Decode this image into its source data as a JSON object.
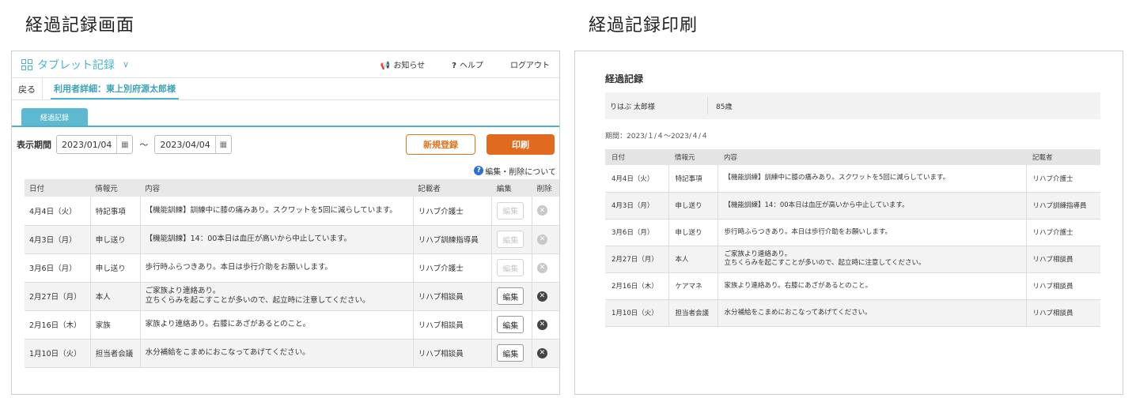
{
  "captions": {
    "left": "経過記録画面",
    "right": "経過記録印刷"
  },
  "app": {
    "brand": "タブレット記録",
    "top_links": [
      {
        "icon": "megaphone-icon",
        "glyph": "📢",
        "label": "お知らせ"
      },
      {
        "icon": "help-icon",
        "glyph": "?",
        "label": "ヘルプ"
      },
      {
        "icon": "",
        "glyph": "",
        "label": "ログアウト"
      }
    ],
    "back": "戻る",
    "user_crumb": "利用者詳細：東上別府源太郎様",
    "tab": "経過記録",
    "filter": {
      "label": "表示期間",
      "from": "2023/01/04",
      "to": "2023/04/04",
      "tilde": "〜",
      "new_button": "新規登録",
      "print_button": "印刷"
    },
    "note": "編集・削除について",
    "headers": [
      "日付",
      "情報元",
      "内容",
      "記載者",
      "編集",
      "削除"
    ],
    "edit_label": "編集",
    "rows": [
      {
        "date": "4月4日（火）",
        "source": "特記事項",
        "content": "【機能訓練】訓練中に膝の痛みあり。スクワットを5回に減らしています。",
        "author": "リハブ介護士",
        "editable": false
      },
      {
        "date": "4月3日（月）",
        "source": "申し送り",
        "content": "【機能訓練】14：00本日は血圧が高いから中止しています。",
        "author": "リハブ訓練指導員",
        "editable": false
      },
      {
        "date": "3月6日（月）",
        "source": "申し送り",
        "content": "歩行時ふらつきあり。本日は歩行介助をお願いします。",
        "author": "リハブ介護士",
        "editable": false
      },
      {
        "date": "2月27日（月）",
        "source": "本人",
        "content": "ご家族より連絡あり。\n立ちくらみを起こすことが多いので、起立時に注意してください。",
        "author": "リハブ相談員",
        "editable": true
      },
      {
        "date": "2月16日（木）",
        "source": "家族",
        "content": "家族より連絡あり。右膝にあざがあるとのこと。",
        "author": "リハブ相談員",
        "editable": true
      },
      {
        "date": "1月10日（火）",
        "source": "担当者会議",
        "content": "水分補給をこまめにおこなってあげてください。",
        "author": "リハブ相談員",
        "editable": true
      }
    ]
  },
  "print": {
    "title": "経過記録",
    "name": "りはぶ 太郎様",
    "age": "85歳",
    "period": "期間：2023/１/４〜2023/４/４",
    "headers": [
      "日付",
      "情報元",
      "内容",
      "記載者"
    ],
    "rows": [
      {
        "date": "4月4日（火）",
        "source": "特記事項",
        "content": "【機能訓練】訓練中に膝の痛みあり。スクワットを5回に減らしています。",
        "author": "リハブ介護士"
      },
      {
        "date": "4月3日（月）",
        "source": "申し送り",
        "content": "【機能訓練】14：00本日は血圧が高いから中止しています。",
        "author": "リハブ訓練指導員"
      },
      {
        "date": "3月6日（月）",
        "source": "申し送り",
        "content": "歩行時ふらつきあり。本日は歩行介助をお願いします。",
        "author": "リハブ介護士"
      },
      {
        "date": "2月27日（月）",
        "source": "本人",
        "content": "ご家族より連絡あり。\n立ちくらみを起こすことが多いので、起立時に注意してください。",
        "author": "リハブ相談員"
      },
      {
        "date": "2月16日（木）",
        "source": "ケアマネ",
        "content": "家族より連絡あり。右膝にあざがあるとのこと。",
        "author": "リハブ相談員"
      },
      {
        "date": "1月10日（火）",
        "source": "担当者会議",
        "content": "水分補給をこまめにおこなってあげてください。",
        "author": "リハブ相談員"
      }
    ]
  }
}
